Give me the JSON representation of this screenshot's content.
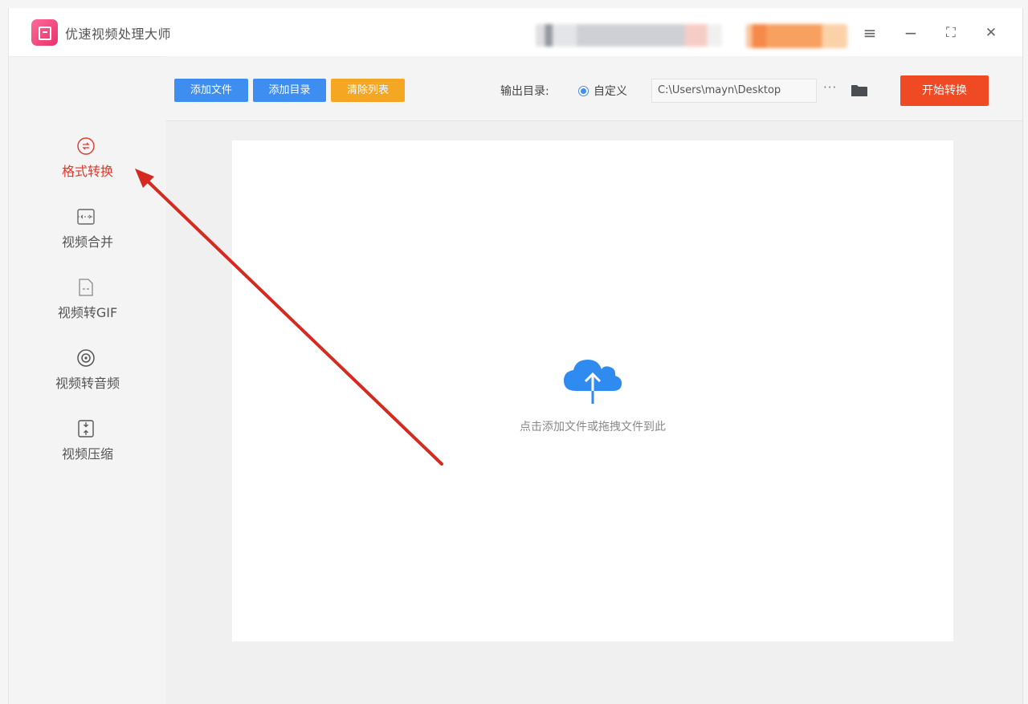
{
  "app": {
    "title": "优速视频处理大师"
  },
  "window_controls": {
    "menu_icon": "≡",
    "minimize_icon": "−",
    "maximize_icon": "⛶",
    "close_icon": "✕"
  },
  "toolbar": {
    "add_file_label": "添加文件",
    "add_folder_label": "添加目录",
    "clear_list_label": "清除列表",
    "output_dir_label": "输出目录:",
    "radio_custom_label": "自定义",
    "path_value": "C:\\Users\\mayn\\Desktop",
    "more_label": "···",
    "start_label": "开始转换"
  },
  "sidebar": {
    "items": [
      {
        "label": "格式转换",
        "icon": "format-convert-icon",
        "active": true
      },
      {
        "label": "视频合并",
        "icon": "merge-icon",
        "active": false
      },
      {
        "label": "视频转GIF",
        "icon": "gif-icon",
        "active": false
      },
      {
        "label": "视频转音频",
        "icon": "audio-icon",
        "active": false
      },
      {
        "label": "视频压缩",
        "icon": "compress-icon",
        "active": false
      }
    ]
  },
  "main": {
    "drop_hint": "点击添加文件或拖拽文件到此"
  },
  "colors": {
    "accent_red": "#e0392b",
    "primary_blue": "#3d8ef0",
    "orange": "#f5a623",
    "start_button": "#f04a25",
    "cloud_blue": "#2f8bef"
  }
}
